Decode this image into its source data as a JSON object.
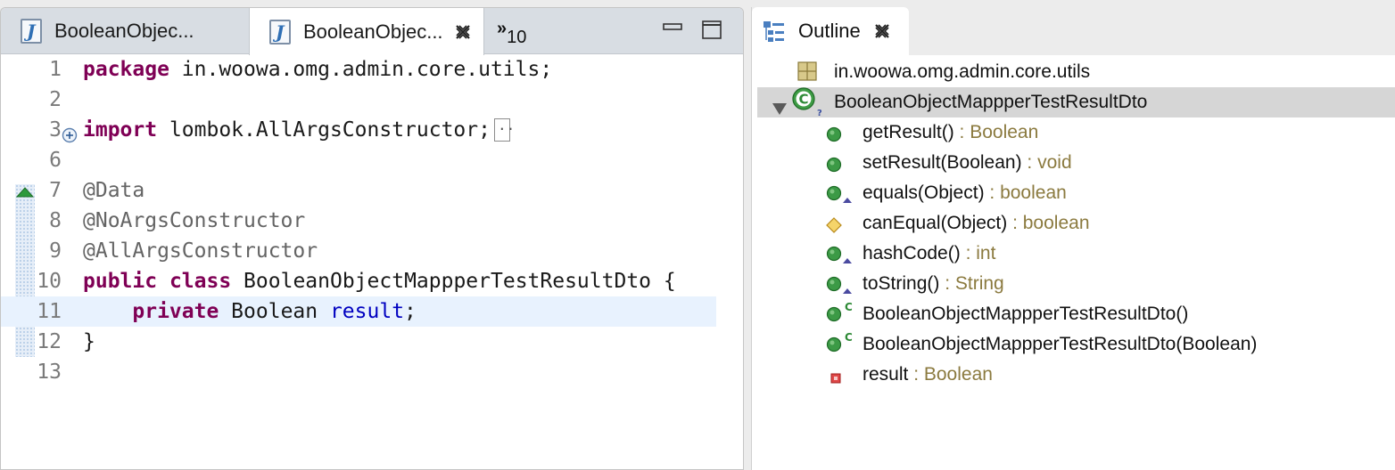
{
  "editor": {
    "tabs": [
      {
        "label": "BooleanObjec...",
        "active": false
      },
      {
        "label": "BooleanObjec...",
        "active": true
      }
    ],
    "overflow": {
      "glyph": "»",
      "count": "10"
    },
    "lines": [
      {
        "num": "1",
        "parts": [
          {
            "cls": "kw",
            "t": "package"
          },
          {
            "cls": "",
            "t": " in.woowa.omg.admin.core.utils;"
          }
        ]
      },
      {
        "num": "2",
        "parts": []
      },
      {
        "num": "3",
        "parts": [
          {
            "cls": "kw",
            "t": "import"
          },
          {
            "cls": "",
            "t": " lombok.AllArgsConstructor;"
          }
        ],
        "folded": true
      },
      {
        "num": "6",
        "parts": []
      },
      {
        "num": "7",
        "parts": [
          {
            "cls": "ann",
            "t": "@Data"
          }
        ]
      },
      {
        "num": "8",
        "parts": [
          {
            "cls": "ann",
            "t": "@NoArgsConstructor"
          }
        ]
      },
      {
        "num": "9",
        "parts": [
          {
            "cls": "ann",
            "t": "@AllArgsConstructor"
          }
        ]
      },
      {
        "num": "10",
        "parts": [
          {
            "cls": "kw",
            "t": "public"
          },
          {
            "cls": "",
            "t": " "
          },
          {
            "cls": "kw",
            "t": "class"
          },
          {
            "cls": "",
            "t": " BooleanObjectMappperTestResultDto {"
          }
        ]
      },
      {
        "num": "11",
        "parts": [
          {
            "cls": "",
            "t": "    "
          },
          {
            "cls": "kw",
            "t": "private"
          },
          {
            "cls": "",
            "t": " Boolean "
          },
          {
            "cls": "field",
            "t": "result"
          },
          {
            "cls": "",
            "t": ";"
          }
        ],
        "current": true
      },
      {
        "num": "12",
        "parts": [
          {
            "cls": "",
            "t": "}"
          }
        ]
      },
      {
        "num": "13",
        "parts": []
      }
    ]
  },
  "outline": {
    "tab_label": "Outline",
    "items": [
      {
        "icon": "package-icon",
        "label": "in.woowa.omg.admin.core.utils",
        "type": "",
        "indent": 0
      },
      {
        "icon": "class-icon",
        "label": "BooleanObjectMappperTestResultDto",
        "type": "",
        "indent": 0,
        "selected": true,
        "expanded": true
      },
      {
        "icon": "public-method-icon",
        "label": "getResult()",
        "type": " : Boolean",
        "indent": 1
      },
      {
        "icon": "public-method-icon",
        "label": "setResult(Boolean)",
        "type": " : void",
        "indent": 1
      },
      {
        "icon": "public-method-override-icon",
        "label": "equals(Object)",
        "type": " : boolean",
        "indent": 1
      },
      {
        "icon": "protected-method-icon",
        "label": "canEqual(Object)",
        "type": " : boolean",
        "indent": 1
      },
      {
        "icon": "public-method-override-icon",
        "label": "hashCode()",
        "type": " : int",
        "indent": 1
      },
      {
        "icon": "public-method-override-icon",
        "label": "toString()",
        "type": " : String",
        "indent": 1
      },
      {
        "icon": "constructor-icon",
        "label": "BooleanObjectMappperTestResultDto()",
        "type": "",
        "indent": 1
      },
      {
        "icon": "constructor-icon",
        "label": "BooleanObjectMappperTestResultDto(Boolean)",
        "type": "",
        "indent": 1
      },
      {
        "icon": "private-field-icon",
        "label": "result",
        "type": " : Boolean",
        "indent": 1
      }
    ]
  },
  "colors": {
    "keyword": "#7f0055",
    "annotation": "#646464",
    "field": "#0000c0",
    "return_type": "#8b7a3f",
    "current_line": "#e8f2fe",
    "selection": "#d6d6d6"
  }
}
